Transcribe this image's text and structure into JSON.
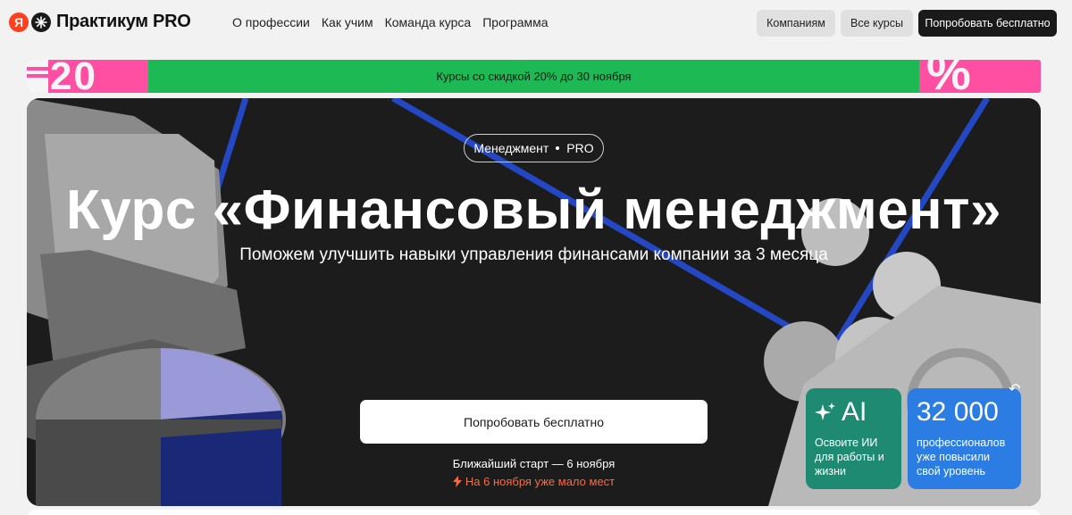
{
  "header": {
    "logo_ya": "Я",
    "logo_text": "Практикум PRO",
    "nav": [
      {
        "label": "О профессии"
      },
      {
        "label": "Как учим"
      },
      {
        "label": "Команда курса"
      },
      {
        "label": "Программа"
      }
    ],
    "companies_label": "Компаниям",
    "all_courses_label": "Все курсы",
    "try_label": "Попробовать бесплатно"
  },
  "promo": {
    "text": "Курсы со скидкой 20% до 30 ноября",
    "left_number": "20",
    "right_symbol": "%",
    "colors": {
      "green": "#1db954",
      "pink": "#ff4fa3"
    }
  },
  "hero": {
    "tag_left": "Менеджмент",
    "tag_right": "PRO",
    "title": "Курс «Финансовый менеджмент»",
    "subtitle": "Поможем улучшить навыки управления финансами компании за 3 месяца",
    "cta_label": "Попробовать бесплатно",
    "start_text": "Ближайший старт — 6 ноября",
    "hurry_text": "На 6 ноября уже мало мест",
    "hurry_icon": "lightning-icon"
  },
  "cards": {
    "ai": {
      "big": "AI",
      "text": "Освоите ИИ для работы и жизни",
      "icon": "sparkle-icon",
      "color": "#1f8a72"
    },
    "stat": {
      "big": "32 000",
      "text": "профессионалов уже повысили свой уровень",
      "color": "#2b7de3"
    }
  }
}
